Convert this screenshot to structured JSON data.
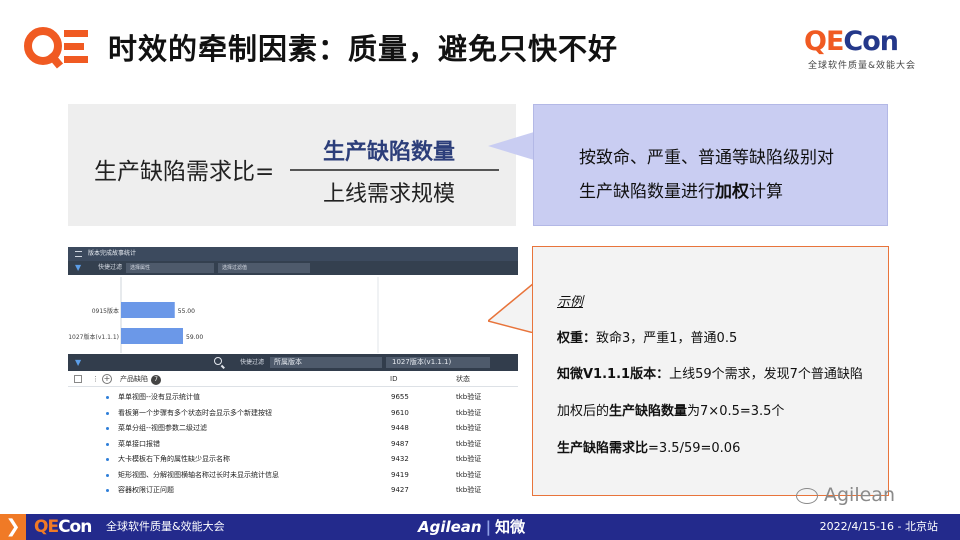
{
  "header": {
    "title": "时效的牵制因素：质量，避免只快不好",
    "brand_qe": "QE",
    "brand_con": "Con",
    "brand_sub": "全球软件质量&效能大会"
  },
  "formula": {
    "label": "生产缺陷需求比=",
    "numerator": "生产缺陷数量",
    "denominator": "上线需求规模"
  },
  "callout": {
    "line1": "按致命、严重、普通等缺陷级别对",
    "line2_prefix": "生产缺陷数量进行",
    "line2_bold": "加权",
    "line2_suffix": "计算"
  },
  "screenshot": {
    "title": "版本完成故事统计",
    "filter_label": "快捷过滤",
    "filter1": "选择属性",
    "filter2": "选择过滤值",
    "toolbar_filter_label": "快捷过滤",
    "toolbar_filter1": "所属版本",
    "toolbar_filter2": "1027版本(v1.1.1)",
    "table_headers": {
      "name": "产品缺陷",
      "count": "7",
      "id": "ID",
      "status": "状态"
    },
    "rows": [
      {
        "name": "单单视图--没有显示统计值",
        "id": "9655",
        "status": "tkb验证"
      },
      {
        "name": "看板第一个步骤有多个状态时会显示多个新建按钮",
        "id": "9610",
        "status": "tkb验证"
      },
      {
        "name": "菜单分组--视图参数二级过滤",
        "id": "9448",
        "status": "tkb验证"
      },
      {
        "name": "菜单接口报错",
        "id": "9487",
        "status": "tkb验证"
      },
      {
        "name": "大卡模板右下角的属性缺少显示名称",
        "id": "9432",
        "status": "tkb验证"
      },
      {
        "name": "矩形视图、分解视图横轴名称过长时未显示统计信息",
        "id": "9419",
        "status": "tkb验证"
      },
      {
        "name": "容器权限订正问题",
        "id": "9427",
        "status": "tkb验证"
      }
    ]
  },
  "chart_data": {
    "type": "bar",
    "categories": [
      "0915版本",
      "1027版本(v1.1.1)"
    ],
    "values": [
      55,
      59
    ],
    "value_labels": [
      "55.00",
      "59.00"
    ],
    "bar_color": "#6b98e8"
  },
  "example": {
    "heading": "示例",
    "weights_bold": "权重：",
    "weights_text": "致命3，严重1，普通0.5",
    "version_bold": "知微V1.1.1版本：",
    "version_text": "上线59个需求，发现7个普通缺陷",
    "weighted_prefix": "加权后的",
    "weighted_bold": "生产缺陷数量",
    "weighted_suffix": "为7×0.5=3.5个",
    "ratio_bold": "生产缺陷需求比",
    "ratio_text": "=3.5/59=0.06"
  },
  "watermark": {
    "text": "Agilean"
  },
  "footer": {
    "brand_qe": "QE",
    "brand_con": "Con",
    "conference": "全球软件质量&效能大会",
    "partner1": "Agilean",
    "partner2": "知微",
    "date": "2022/4/15-16 - 北京站"
  },
  "colors": {
    "orange": "#f05a22",
    "navy": "#24388a",
    "footer_bg": "#232a8c",
    "callout_bg": "#c9cdf2",
    "example_border": "#e8743b"
  }
}
